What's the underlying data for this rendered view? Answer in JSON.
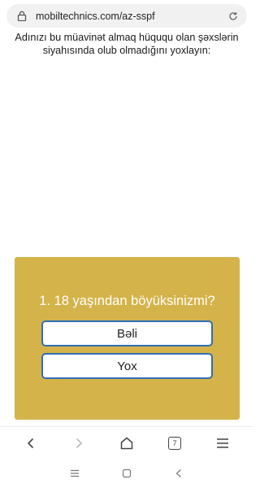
{
  "browser": {
    "url": "mobiltechnics.com/az-sspf",
    "tab_count": "7"
  },
  "page": {
    "intro_text": "Adınızı bu müavinət almaq hüququ olan şəxslərin siyahısında olub olmadığını yoxlayın:"
  },
  "quiz": {
    "question": "1. 18 yaşından böyüksinizmi?",
    "answer_yes": "Bəli",
    "answer_no": "Yox"
  },
  "colors": {
    "card_background": "#d4b34a",
    "button_border": "#2f6fb3"
  },
  "icons": {
    "lock": "lock-icon",
    "reload": "reload-icon",
    "back": "back-arrow-icon",
    "forward": "forward-arrow-icon",
    "home": "home-icon",
    "tabs": "tabs-icon",
    "menu": "menu-icon",
    "recents": "recents-icon",
    "system_home": "system-home-icon",
    "system_back": "system-back-icon"
  }
}
